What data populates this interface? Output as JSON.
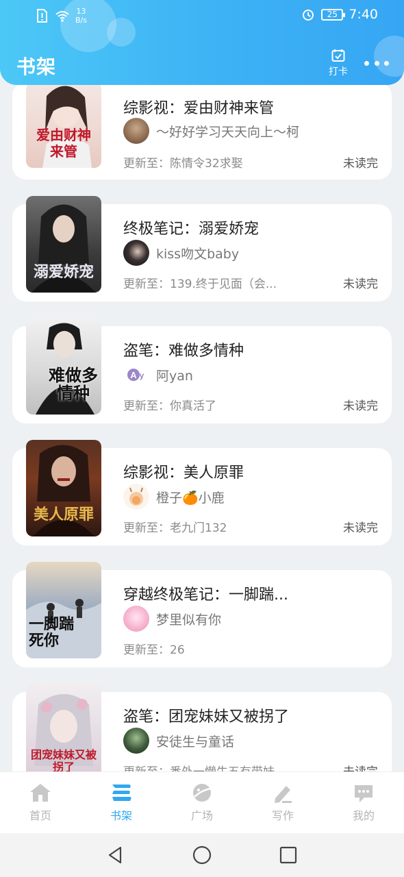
{
  "status_bar": {
    "net_speed_value": "13",
    "net_speed_unit": "B/s",
    "battery": "25",
    "time": "7:40"
  },
  "header": {
    "title": "书架",
    "checkin_label": "打卡"
  },
  "books": [
    {
      "title": "综影视：爱由财神来管",
      "author": "～好好学习天天向上～柯",
      "update": "更新至：陈情令32求娶",
      "status": "未读完",
      "cover_text": "爱由财神来管"
    },
    {
      "title": "终极笔记：溺爱娇宠",
      "author": "kiss吻文baby",
      "update": "更新至：139.终于见面（会...",
      "status": "未读完",
      "cover_text": "溺爱娇宠"
    },
    {
      "title": "盗笔：难做多情种",
      "author": "阿yan",
      "update": "更新至：你真活了",
      "status": "未读完",
      "cover_text": "难做多情种"
    },
    {
      "title": "综影视：美人原罪",
      "author": "橙子🍊小鹿",
      "update": "更新至：老九门132",
      "status": "未读完",
      "cover_text": "美人原罪"
    },
    {
      "title": "穿越终极笔记：一脚踹...",
      "author": "梦里似有你",
      "update": "更新至：26",
      "status": "",
      "cover_text": "一脚踹死你"
    },
    {
      "title": "盗笔：团宠妹妹又被拐了",
      "author": "安徒生与童话",
      "update": "更新至：番外一懒牛五有带妹",
      "status": "未读完",
      "cover_text": "团宠妹妹又被拐了"
    }
  ],
  "tabs": [
    {
      "label": "首页",
      "icon": "home-icon"
    },
    {
      "label": "书架",
      "icon": "bookshelf-icon"
    },
    {
      "label": "广场",
      "icon": "planet-icon"
    },
    {
      "label": "写作",
      "icon": "pen-icon"
    },
    {
      "label": "我的",
      "icon": "chat-bubble-icon"
    }
  ],
  "colors": {
    "header_start": "#4cc8f6",
    "header_end": "#36a6f4",
    "accent": "#2fa8f0",
    "inactive": "#b4b4b4"
  }
}
